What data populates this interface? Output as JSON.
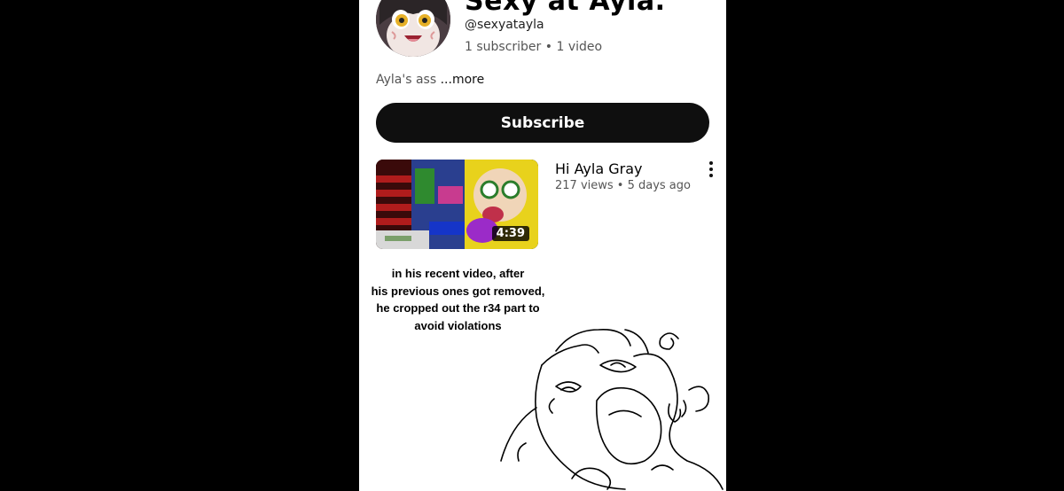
{
  "channel": {
    "title": "Sexy at Ayla.",
    "handle": "@sexyatayla",
    "stats": "1 subscriber • 1 video",
    "description": "Ayla's ass",
    "more_label": " ...more",
    "subscribe_label": "Subscribe"
  },
  "video": {
    "title": "Hi Ayla Gray",
    "meta": "217 views • 5 days ago",
    "duration": "4:39"
  },
  "caption_lines": [
    "in his recent video, after",
    "his previous ones got removed,",
    "he cropped out the r34 part to",
    "avoid violations"
  ],
  "colors": {
    "page_bg": "#000000",
    "subscribe_bg": "#0f0f0f",
    "text_secondary": "#555555"
  },
  "icons": [
    "kebab-menu-icon"
  ]
}
